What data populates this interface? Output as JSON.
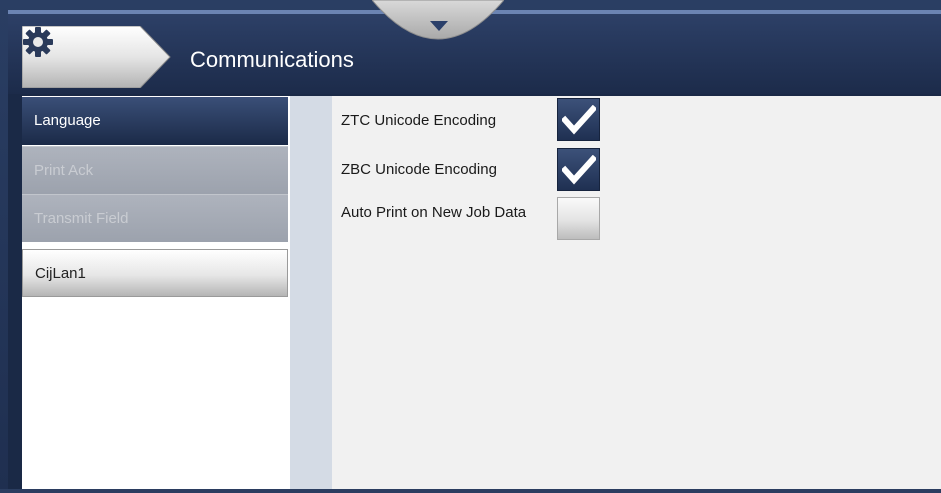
{
  "header": {
    "title": "Communications",
    "home_icon": "gear-icon",
    "pulldown_icon": "chevron-down-icon"
  },
  "sidebar": {
    "items": [
      {
        "label": "Language",
        "state": "active"
      },
      {
        "label": "Print Ack",
        "state": "disabled"
      },
      {
        "label": "Transmit Field",
        "state": "disabled"
      },
      {
        "label": "CijLan1",
        "state": "normal"
      }
    ]
  },
  "options": [
    {
      "label": "ZTC Unicode Encoding",
      "checked": true
    },
    {
      "label": "ZBC Unicode Encoding",
      "checked": true
    },
    {
      "label": "Auto Print on New Job Data",
      "checked": false
    }
  ],
  "colors": {
    "header_bg": "#1c2b4a",
    "accent": "#2f4470",
    "disabled_item": "#a3a8b2",
    "panel_bg": "#f1f1f1",
    "splitter": "#d4dbe5"
  }
}
